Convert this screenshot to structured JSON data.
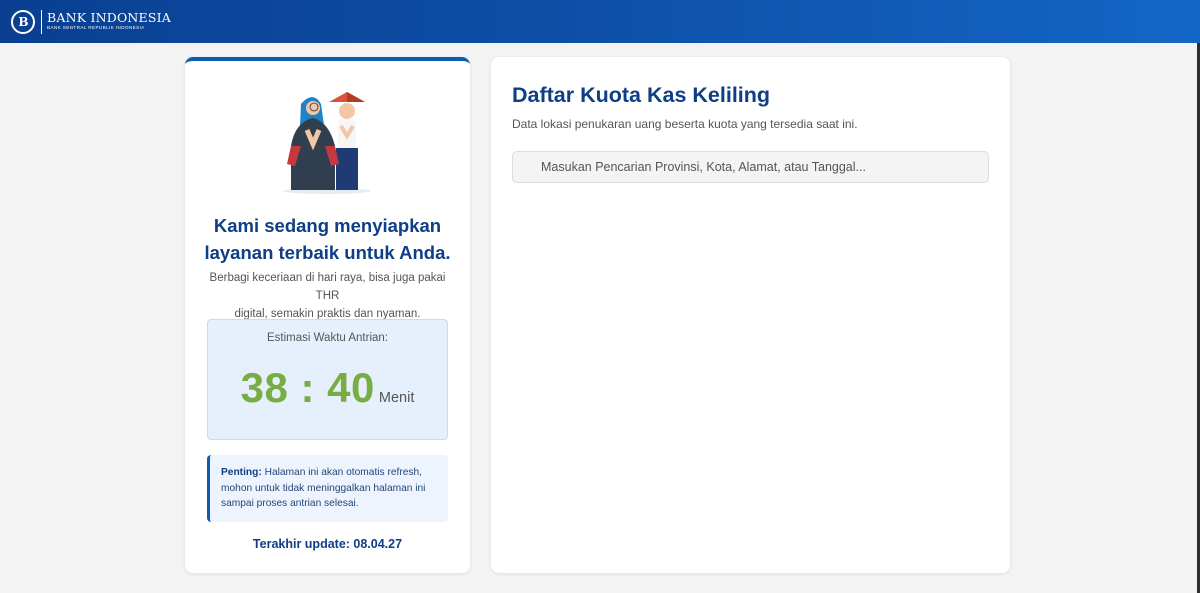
{
  "header": {
    "logo_mark": "B",
    "brand_name": "BANK INDONESIA",
    "brand_sub": "BANK SENTRAL REPUBLIK INDONESIA"
  },
  "queue_card": {
    "heading_line1": "Kami sedang menyiapkan",
    "heading_line2": "layanan terbaik untuk Anda.",
    "subtext_line1": "Berbagi keceriaan di hari raya, bisa juga pakai THR",
    "subtext_line2": "digital, semakin praktis dan nyaman.",
    "estimate_label": "Estimasi Waktu Antrian:",
    "estimate_time": "38 : 40",
    "estimate_unit": "Menit",
    "notice_label": "Penting:",
    "notice_text": "Halaman ini akan otomatis refresh, mohon untuk tidak meninggalkan halaman ini sampai proses antrian selesai.",
    "last_update": "Terakhir update: 08.04.27"
  },
  "kuota_panel": {
    "title": "Daftar Kuota Kas Keliling",
    "description": "Data lokasi penukaran uang beserta kuota yang tersedia saat ini.",
    "search_placeholder": "Masukan Pencarian Provinsi, Kota, Alamat, atau Tanggal...",
    "search_value": ""
  },
  "colors": {
    "brand_blue": "#0e3f86",
    "accent_blue": "#0d5bb5",
    "timer_green": "#77ad43",
    "queue_box_bg": "#e6f0fd"
  },
  "icons": {
    "logo": "bank-indonesia-logo-icon",
    "illustration": "greeting-people-illustration",
    "search": "search-icon"
  }
}
